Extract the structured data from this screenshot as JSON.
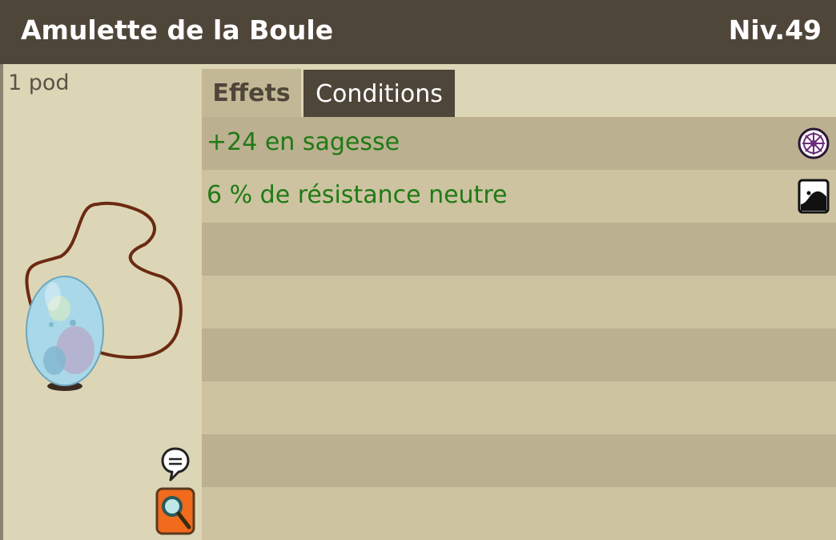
{
  "item": {
    "name": "Amulette de la Boule",
    "level": "Niv.49",
    "weight": "1 pod"
  },
  "tabs": [
    {
      "label": "Effets",
      "active": true
    },
    {
      "label": "Conditions",
      "active": false
    }
  ],
  "effects": [
    {
      "text": "+24 en sagesse",
      "icon": "wisdom-icon"
    },
    {
      "text": "6 % de résistance neutre",
      "icon": "neutral-resistance-icon"
    }
  ],
  "colors": {
    "header": "#4f463a",
    "panel": "#dcd6b6",
    "row_dark": "#bbb08f",
    "row_light": "#cdc3a0",
    "effect_text": "#1f7a16"
  }
}
